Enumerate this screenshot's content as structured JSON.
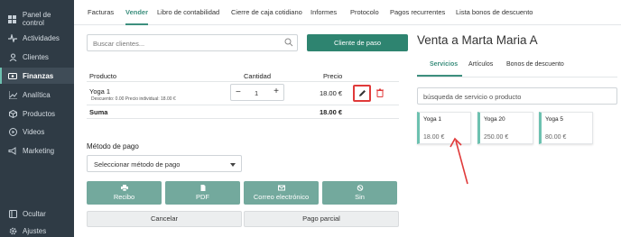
{
  "sidebar": {
    "items": [
      {
        "label": "Panel de control",
        "icon": "dashboard-icon"
      },
      {
        "label": "Actividades",
        "icon": "activity-icon"
      },
      {
        "label": "Clientes",
        "icon": "user-icon"
      },
      {
        "label": "Finanzas",
        "icon": "finance-icon",
        "active": true
      },
      {
        "label": "Analítica",
        "icon": "chart-icon"
      },
      {
        "label": "Productos",
        "icon": "box-icon"
      },
      {
        "label": "Videos",
        "icon": "play-icon"
      },
      {
        "label": "Marketing",
        "icon": "megaphone-icon"
      }
    ],
    "bottom": [
      {
        "label": "Ocultar",
        "icon": "collapse-icon"
      },
      {
        "label": "Ajustes",
        "icon": "gear-icon"
      }
    ]
  },
  "tabs": [
    "Facturas",
    "Vender",
    "Libro de contabilidad",
    "Cierre de caja cotidiano",
    "Informes",
    "Protocolo",
    "Pagos recurrentes",
    "Lista bonos de descuento"
  ],
  "active_tab": "Vender",
  "search": {
    "placeholder": "Buscar clientes..."
  },
  "client_button": "Cliente de paso",
  "title": "Venta a Marta Maria A",
  "table": {
    "headers": {
      "product": "Producto",
      "quantity": "Cantidad",
      "price": "Precio"
    },
    "row": {
      "name": "Yoga 1",
      "sub": "Descuento: 0.00 Precio individual: 18.00 €",
      "minus": "−",
      "quantity": "1",
      "plus": "+",
      "price": "18.00 €"
    },
    "sum_label": "Suma",
    "sum_value": "18.00 €"
  },
  "payment": {
    "label": "Método de pago",
    "select": "Seleccionar método de pago",
    "buttons": [
      {
        "label": "Recibo",
        "icon": "print-icon"
      },
      {
        "label": "PDF",
        "icon": "document-icon"
      },
      {
        "label": "Correo electrónico",
        "icon": "mail-icon"
      },
      {
        "label": "Sin",
        "icon": "ban-icon"
      }
    ],
    "cancel": "Cancelar",
    "partial": "Pago parcial"
  },
  "right_panel": {
    "tabs": [
      "Servicios",
      "Artículos",
      "Bonos de descuento"
    ],
    "active_tab": "Servicios",
    "search_placeholder": "búsqueda de servicio o producto",
    "cards": [
      {
        "name": "Yoga 1",
        "price": "18.00 €"
      },
      {
        "name": "Yoga 20",
        "price": "250.00 €"
      },
      {
        "name": "Yoga 5",
        "price": "80.00 €"
      }
    ]
  },
  "colors": {
    "sidebar_bg": "#2f3b45",
    "accent": "#2e8470",
    "pay_button": "#73a99d",
    "highlight": "#e03a3a",
    "card_accent": "#6dc1b0"
  }
}
